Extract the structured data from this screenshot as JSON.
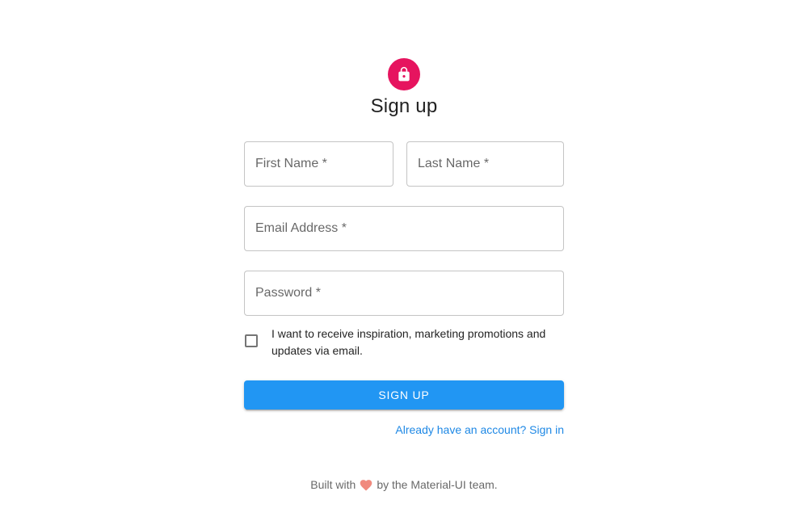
{
  "header": {
    "avatar_icon": "lock-icon",
    "avatar_color": "#e6145f",
    "title": "Sign up"
  },
  "form": {
    "first_name": {
      "label": "First Name *",
      "value": ""
    },
    "last_name": {
      "label": "Last Name *",
      "value": ""
    },
    "email": {
      "label": "Email Address *",
      "value": ""
    },
    "password": {
      "label": "Password *",
      "value": ""
    },
    "marketing_checkbox": {
      "label": "I want to receive inspiration, marketing promotions and updates via email.",
      "checked": false
    },
    "submit_label": "Sign Up",
    "submit_color": "#2196f3",
    "signin_link": "Already have an account? Sign in",
    "link_color": "#1e88e5"
  },
  "footer": {
    "prefix": "Built with",
    "heart_icon": "heart-icon",
    "suffix": "by the Material-UI team."
  }
}
